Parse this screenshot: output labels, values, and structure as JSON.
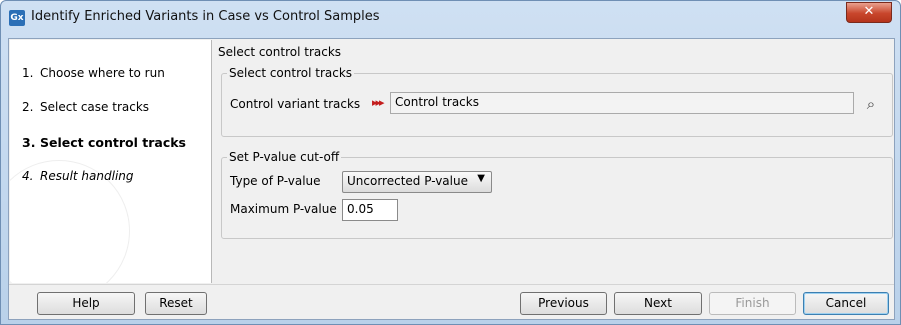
{
  "window": {
    "app_icon": "Gx",
    "title": "Identify Enriched Variants in Case vs Control Samples",
    "close_glyph": "✕"
  },
  "steps": [
    {
      "num": "1.",
      "label": "Choose where to run",
      "state": "normal"
    },
    {
      "num": "2.",
      "label": "Select case tracks",
      "state": "normal"
    },
    {
      "num": "3.",
      "label": "Select control tracks",
      "state": "current"
    },
    {
      "num": "4.",
      "label": "Result handling",
      "state": "italic"
    }
  ],
  "content": {
    "title": "Select control tracks",
    "control_group": {
      "legend": "Select control tracks",
      "field_label": "Control variant tracks",
      "track_icon": "variant-track-icon",
      "value": "Control tracks",
      "browse_icon": "browse-icon"
    },
    "pvalue_group": {
      "legend": "Set P-value cut-off",
      "type_label": "Type of P-value",
      "type_value": "Uncorrected P-value",
      "max_label": "Maximum P-value",
      "max_value": "0.05"
    }
  },
  "footer": {
    "help": "Help",
    "reset": "Reset",
    "previous": "Previous",
    "next": "Next",
    "finish": "Finish",
    "cancel": "Cancel"
  },
  "colors": {
    "close_button": "#c8462c",
    "track_icon": "#c41e1e",
    "titlebar": "#c4d9ef"
  }
}
